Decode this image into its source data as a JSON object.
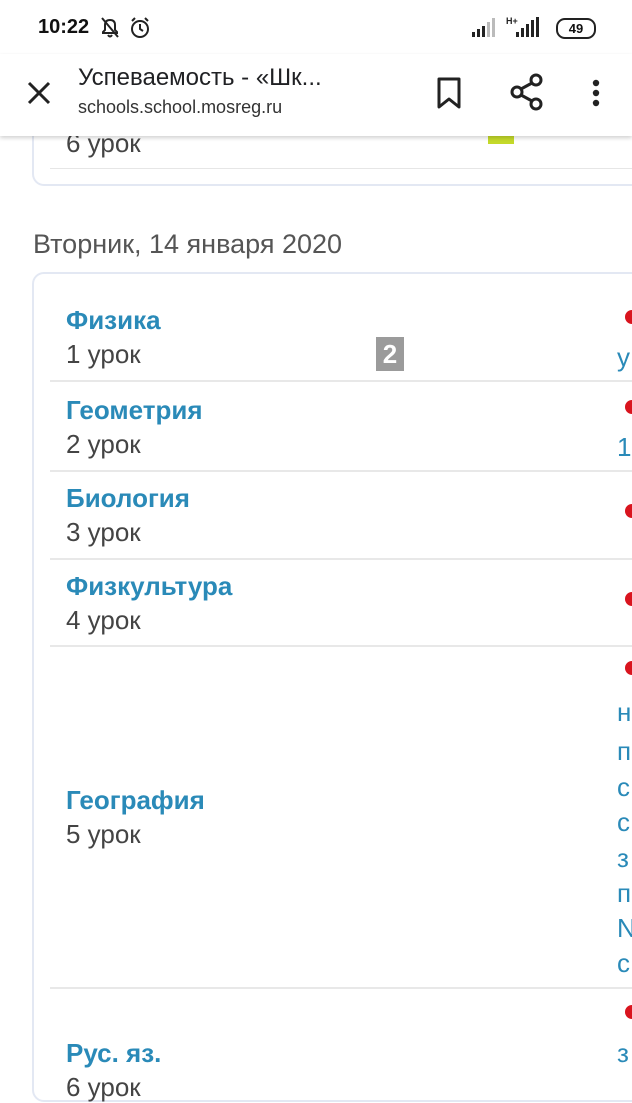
{
  "status": {
    "time": "10:22",
    "battery": "49",
    "network": "H+"
  },
  "appbar": {
    "title": "Успеваемость - «Шк...",
    "url": "schools.school.mosreg.ru"
  },
  "prev_day": {
    "last_lesson": "6 урок"
  },
  "day": {
    "heading": "Вторник, 14 января 2020",
    "lessons": [
      {
        "subject": "Физика",
        "lesson": "1 урок",
        "grade": "2",
        "right_text": [
          "у"
        ]
      },
      {
        "subject": "Геометрия",
        "lesson": "2 урок",
        "right_text": [
          "1"
        ]
      },
      {
        "subject": "Биология",
        "lesson": "3 урок",
        "right_text": []
      },
      {
        "subject": "Физкультура",
        "lesson": "4 урок",
        "right_text": []
      },
      {
        "subject": "География",
        "lesson": "5 урок",
        "right_text": [
          "н",
          "п",
          "с",
          "с",
          "з",
          "п",
          "N",
          "с"
        ]
      },
      {
        "subject": "Рус. яз.",
        "lesson": "6 урок",
        "right_text": [
          "з"
        ]
      }
    ]
  },
  "colors": {
    "subject": "#2a8ab8",
    "dot": "#d9141e",
    "badge": "#9b9b9b",
    "marker": "#c4d92a"
  }
}
